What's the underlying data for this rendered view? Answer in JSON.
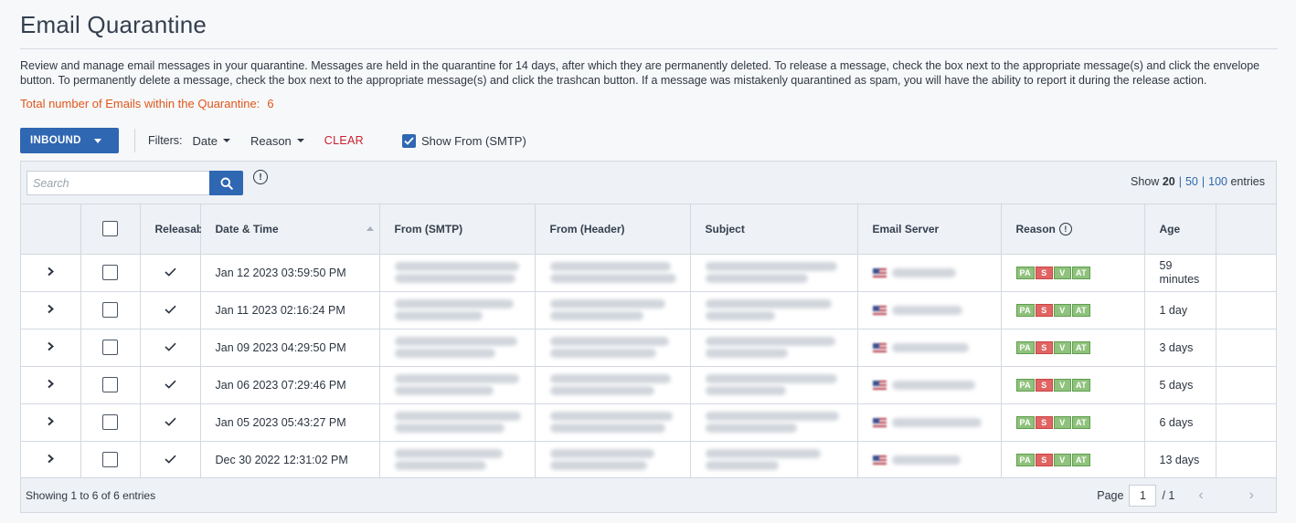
{
  "page": {
    "title": "Email Quarantine",
    "description": "Review and manage email messages in your quarantine. Messages are held in the quarantine for 14 days, after which they are permanently deleted. To release a message, check the box next to the appropriate message(s) and click the envelope button. To permanently delete a message, check the box next to the appropriate message(s) and click the trashcan button. If a message was mistakenly quarantined as spam, you will have the ability to report it during the release action.",
    "total_label": "Total number of Emails within the Quarantine:",
    "total_count": "6"
  },
  "toolbar": {
    "direction_label": "INBOUND",
    "filters_label": "Filters:",
    "date_filter": "Date",
    "reason_filter": "Reason",
    "clear_label": "CLEAR",
    "show_from_label": "Show From (SMTP)",
    "show_from_checked": true
  },
  "search": {
    "placeholder": "Search",
    "show_prefix": "Show",
    "page_size_options": [
      "20",
      "50",
      "100"
    ],
    "selected_page_size": "20",
    "show_suffix": "entries"
  },
  "table": {
    "columns": {
      "releasable": "Releasable",
      "date_time": "Date & Time",
      "from_smtp": "From (SMTP)",
      "from_header": "From (Header)",
      "subject": "Subject",
      "email_server": "Email Server",
      "reason": "Reason",
      "age": "Age"
    },
    "reason_badges": [
      "PA",
      "S",
      "V",
      "AT"
    ],
    "rows": [
      {
        "date": "Jan 12 2023 03:59:50 PM",
        "age": "59 minutes",
        "releasable": true
      },
      {
        "date": "Jan 11 2023 02:16:24 PM",
        "age": "1 day",
        "releasable": true
      },
      {
        "date": "Jan 09 2023 04:29:50 PM",
        "age": "3 days",
        "releasable": true
      },
      {
        "date": "Jan 06 2023 07:29:46 PM",
        "age": "5 days",
        "releasable": true
      },
      {
        "date": "Jan 05 2023 05:43:27 PM",
        "age": "6 days",
        "releasable": true
      },
      {
        "date": "Dec 30 2022 12:31:02 PM",
        "age": "13 days",
        "releasable": true
      }
    ]
  },
  "footer": {
    "showing_text": "Showing 1 to 6 of 6 entries",
    "page_label": "Page",
    "page_value": "1",
    "page_total": "/ 1"
  },
  "colors": {
    "primary": "#2f67b2",
    "total_orange": "#e0561b",
    "clear_red": "#c8202f",
    "badge_green": "#8fc27c",
    "badge_red": "#e06464"
  },
  "icons": {
    "expand": "chevron-right-icon",
    "search": "search-icon",
    "info": "info-icon",
    "releasable": "check-icon",
    "sort": "sort-asc-icon"
  }
}
